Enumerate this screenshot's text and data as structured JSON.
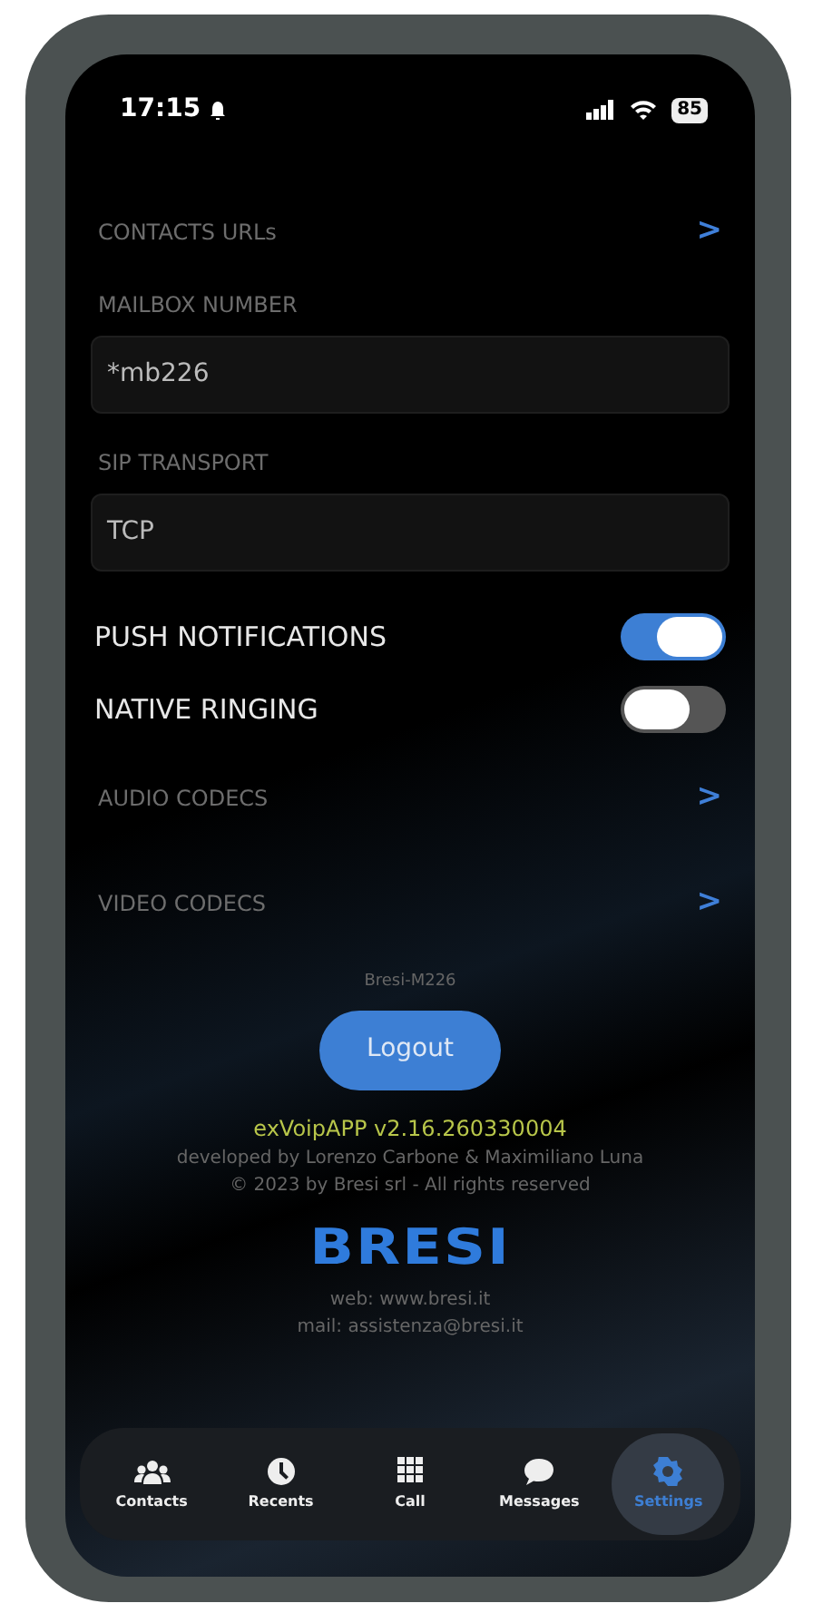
{
  "status_bar": {
    "time": "17:15",
    "battery": "85"
  },
  "settings": [
    {
      "kind": "link",
      "label": "CONTACTS URLs",
      "arrow": ">"
    },
    {
      "kind": "field",
      "label": "MAILBOX NUMBER",
      "value": "*mb226"
    },
    {
      "kind": "field",
      "label": "SIP TRANSPORT",
      "value": "TCP"
    },
    {
      "kind": "toggle",
      "label": "PUSH NOTIFICATIONS",
      "on": true
    },
    {
      "kind": "toggle",
      "label": "NATIVE RINGING",
      "on": false
    },
    {
      "kind": "link",
      "label": "AUDIO CODECS",
      "arrow": ">"
    },
    {
      "kind": "link",
      "label": "VIDEO CODECS",
      "arrow": ">"
    }
  ],
  "account": "Bresi-M226",
  "logout_button": "Logout",
  "footer": {
    "version": "exVoipAPP v2.16.260330004",
    "developers": "developed by Lorenzo Carbone & Maximiliano Luna",
    "copyright": "© 2023 by Bresi srl - All rights reserved",
    "logo": "BRESI",
    "web": "web: www.bresi.it",
    "mail": "mail: assistenza@bresi.it"
  },
  "tabs": [
    {
      "label": "Contacts",
      "kind": "people",
      "selected": false
    },
    {
      "label": "Recents",
      "kind": "clock",
      "selected": false
    },
    {
      "label": "Call",
      "kind": "grid",
      "selected": false
    },
    {
      "label": "Messages",
      "kind": "chat",
      "selected": false
    },
    {
      "label": "Settings",
      "kind": "gear",
      "selected": true
    }
  ]
}
